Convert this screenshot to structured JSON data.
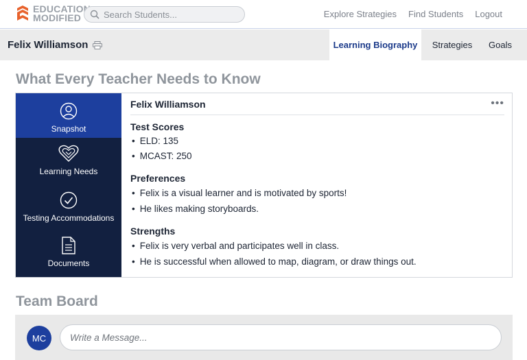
{
  "brand": {
    "line1": "EDUCATION",
    "line2": "MODIFIED",
    "color": "#e8622c"
  },
  "search": {
    "placeholder": "Search Students..."
  },
  "topnav": [
    "Explore Strategies",
    "Find Students",
    "Logout"
  ],
  "student": {
    "name": "Felix Williamson"
  },
  "tabs": [
    {
      "label": "Learning Biography",
      "active": true
    },
    {
      "label": "Strategies",
      "active": false
    },
    {
      "label": "Goals",
      "active": false
    }
  ],
  "section_title": "What Every Teacher Needs to Know",
  "sidenav": [
    {
      "label": "Snapshot",
      "icon": "user-circle-icon",
      "active": true
    },
    {
      "label": "Learning Needs",
      "icon": "heart-icon",
      "active": false
    },
    {
      "label": "Testing Accommodations",
      "icon": "check-circle-icon",
      "active": false
    },
    {
      "label": "Documents",
      "icon": "document-icon",
      "active": false
    }
  ],
  "snapshot": {
    "title": "Felix Williamson",
    "more": "•••",
    "sections": [
      {
        "heading": "Test Scores",
        "items": [
          "ELD: 135",
          "MCAST: 250"
        ]
      },
      {
        "heading": "Preferences",
        "items": [
          "Felix is a visual learner and is motivated by sports!",
          "He likes making storyboards."
        ]
      },
      {
        "heading": "Strengths",
        "items": [
          "Felix is very verbal and participates well in class.",
          "He is successful when allowed to map, diagram, or draw things out."
        ]
      }
    ]
  },
  "board": {
    "title": "Team Board",
    "avatar_initials": "MC",
    "message_placeholder": "Write a Message..."
  },
  "colors": {
    "primary": "#1d3f9e",
    "navy": "#122040",
    "muted_heading": "#8f959c"
  }
}
